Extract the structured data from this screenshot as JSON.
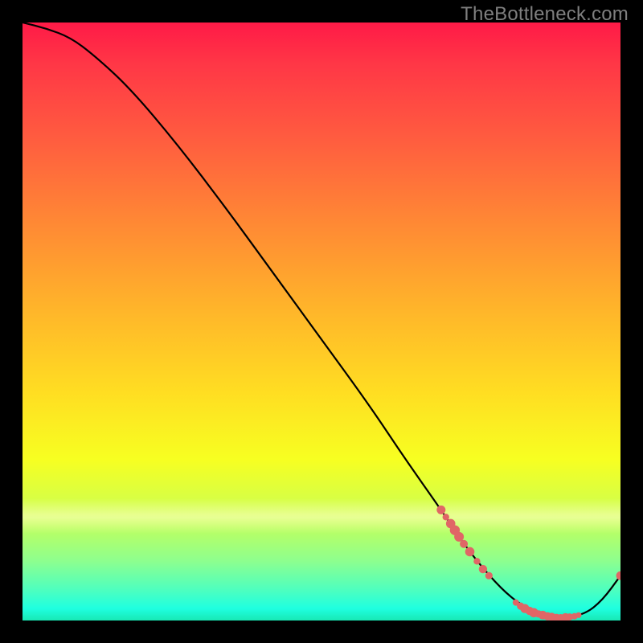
{
  "watermark": "TheBottleneck.com",
  "chart_data": {
    "type": "line",
    "title": "",
    "xlabel": "",
    "ylabel": "",
    "xlim": [
      0,
      100
    ],
    "ylim": [
      0,
      100
    ],
    "grid": false,
    "legend": false,
    "annotations": [
      {
        "text": "TheBottleneck.com",
        "position": "top-right",
        "color": "#7f7f7f"
      }
    ],
    "background_gradient": {
      "direction": "vertical",
      "stops": [
        {
          "pos": 0.0,
          "color": "#ff1a47"
        },
        {
          "pos": 0.2,
          "color": "#ff5e3f"
        },
        {
          "pos": 0.48,
          "color": "#ffb52a"
        },
        {
          "pos": 0.73,
          "color": "#f7ff21"
        },
        {
          "pos": 0.9,
          "color": "#8eff8e"
        },
        {
          "pos": 1.0,
          "color": "#18e8b4"
        }
      ]
    },
    "series": [
      {
        "name": "bottleneck-curve",
        "color": "#000000",
        "x": [
          0,
          4,
          8,
          12,
          18,
          26,
          34,
          42,
          50,
          58,
          64,
          70,
          74,
          78,
          82,
          86,
          90,
          94,
          97,
          100
        ],
        "y": [
          100,
          99,
          97.5,
          94.5,
          89,
          79.5,
          69,
          58,
          47,
          36,
          27,
          18.5,
          12.5,
          7.5,
          3.5,
          1.2,
          0.4,
          1.0,
          3.4,
          7.5
        ]
      }
    ],
    "markers": {
      "name": "highlight-points",
      "color": "#e06666",
      "radius_range": [
        3.5,
        6.5
      ],
      "points": [
        {
          "x": 70.0,
          "y": 18.5,
          "r": 5.5
        },
        {
          "x": 70.8,
          "y": 17.3,
          "r": 4.2
        },
        {
          "x": 71.6,
          "y": 16.2,
          "r": 5.8
        },
        {
          "x": 72.3,
          "y": 15.1,
          "r": 6.2
        },
        {
          "x": 73.0,
          "y": 14.0,
          "r": 6.0
        },
        {
          "x": 73.8,
          "y": 12.8,
          "r": 5.0
        },
        {
          "x": 74.8,
          "y": 11.5,
          "r": 5.8
        },
        {
          "x": 76.0,
          "y": 9.9,
          "r": 4.2
        },
        {
          "x": 77.0,
          "y": 8.6,
          "r": 5.2
        },
        {
          "x": 78.0,
          "y": 7.5,
          "r": 4.6
        },
        {
          "x": 82.5,
          "y": 3.0,
          "r": 4.0
        },
        {
          "x": 83.3,
          "y": 2.4,
          "r": 4.6
        },
        {
          "x": 84.0,
          "y": 2.0,
          "r": 5.6
        },
        {
          "x": 84.8,
          "y": 1.6,
          "r": 5.2
        },
        {
          "x": 85.5,
          "y": 1.3,
          "r": 5.8
        },
        {
          "x": 86.3,
          "y": 1.1,
          "r": 4.6
        },
        {
          "x": 87.0,
          "y": 0.9,
          "r": 5.4
        },
        {
          "x": 87.8,
          "y": 0.7,
          "r": 5.2
        },
        {
          "x": 88.5,
          "y": 0.6,
          "r": 5.2
        },
        {
          "x": 89.3,
          "y": 0.5,
          "r": 4.6
        },
        {
          "x": 90.0,
          "y": 0.4,
          "r": 5.0
        },
        {
          "x": 90.8,
          "y": 0.5,
          "r": 5.4
        },
        {
          "x": 91.5,
          "y": 0.6,
          "r": 4.4
        },
        {
          "x": 92.3,
          "y": 0.7,
          "r": 4.0
        },
        {
          "x": 93.0,
          "y": 0.9,
          "r": 3.6
        },
        {
          "x": 100.0,
          "y": 7.5,
          "r": 5.4
        }
      ]
    }
  },
  "colors": {
    "curve": "#000000",
    "marker": "#e06666",
    "watermark": "#7f7f7f",
    "frame": "#000000"
  }
}
